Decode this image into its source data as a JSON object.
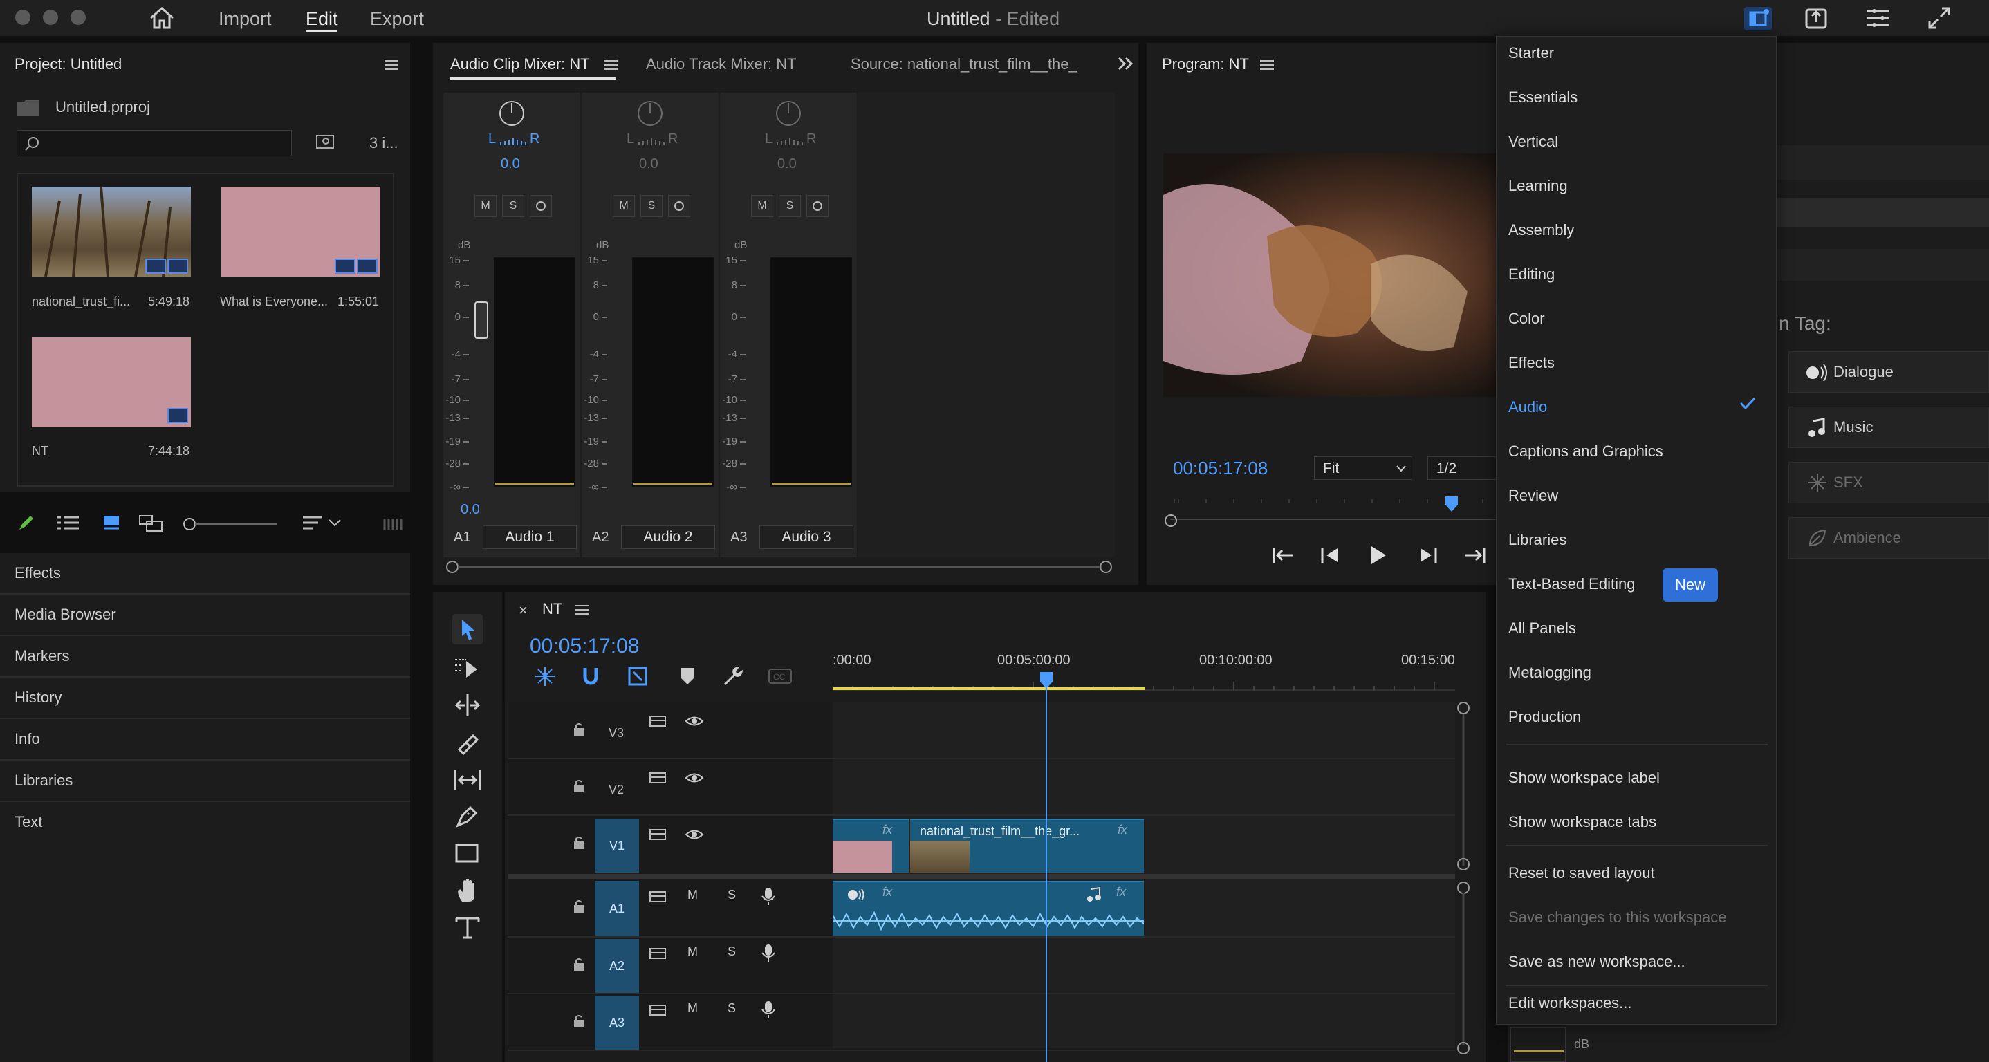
{
  "window": {
    "title": "Untitled",
    "title_suffix": "- Edited"
  },
  "nav": {
    "import": "Import",
    "edit": "Edit",
    "export": "Export"
  },
  "project": {
    "title": "Project: Untitled",
    "file": "Untitled.prproj",
    "count": "3 i...",
    "items": [
      {
        "name": "national_trust_fi...",
        "duration": "5:49:18"
      },
      {
        "name": "What is Everyone...",
        "duration": "1:55:01"
      },
      {
        "name": "NT",
        "duration": "7:44:18"
      }
    ]
  },
  "left_list": [
    "Effects",
    "Media Browser",
    "Markers",
    "History",
    "Info",
    "Libraries",
    "Text"
  ],
  "mixer": {
    "tabs": [
      "Audio Clip Mixer: NT",
      "Audio Track Mixer: NT",
      "Source: national_trust_film__the_"
    ],
    "strips": [
      {
        "id": "A1",
        "name": "Audio 1",
        "value": "0.0"
      },
      {
        "id": "A2",
        "name": "Audio 2",
        "value": "0.0"
      },
      {
        "id": "A3",
        "name": "Audio 3",
        "value": "0.0"
      }
    ],
    "master_value": "0.0",
    "lr_left": "L",
    "lr_right": "R",
    "db_label": "dB",
    "db_ticks": [
      "15",
      "8",
      "0",
      "-4",
      "-7",
      "-10",
      "-13",
      "-19",
      "-28",
      "-∞"
    ],
    "btn_m": "M",
    "btn_s": "S"
  },
  "program": {
    "title": "Program: NT",
    "timecode": "00:05:17:08",
    "fit": "Fit",
    "quality": "1/2"
  },
  "timeline": {
    "seq_name": "NT",
    "timecode": "00:05:17:08",
    "ruler": [
      ":00:00",
      "00:05:00:00",
      "00:10:00:00",
      "00:15:00"
    ],
    "video_tracks": [
      "V3",
      "V2",
      "V1"
    ],
    "audio_tracks": [
      "A1",
      "A2",
      "A3"
    ],
    "clip_name": "national_trust_film__the_gr...",
    "fx": "fx",
    "m": "M",
    "s": "S"
  },
  "workspaces": {
    "items": [
      "Starter",
      "Essentials",
      "Vertical",
      "Learning",
      "Assembly",
      "Editing",
      "Color",
      "Effects",
      "Audio",
      "Captions and Graphics",
      "Review",
      "Libraries",
      "Text-Based Editing",
      "All Panels",
      "Metalogging",
      "Production"
    ],
    "selected": "Audio",
    "new_badge": "New",
    "options": [
      "Show workspace label",
      "Show workspace tabs"
    ],
    "actions": [
      "Reset to saved layout",
      "Save changes to this workspace",
      "Save as new workspace...",
      "Edit workspaces..."
    ]
  },
  "essential_sound": {
    "tag_label": "n Tag:",
    "tags": [
      "Dialogue",
      "Music",
      "SFX",
      "Ambience"
    ],
    "db": "dB"
  },
  "colors": {
    "accent": "#4c9cff",
    "timecode": "#4f9dff",
    "clip": "#1a5a7d",
    "track_label": "#1e4f70",
    "new_badge": "#2f6fd8"
  }
}
